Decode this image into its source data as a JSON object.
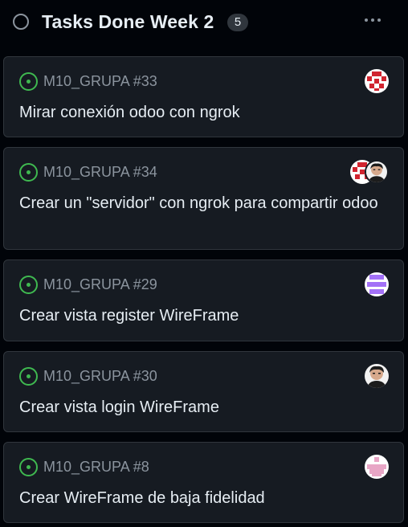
{
  "column": {
    "title": "Tasks Done Week 2",
    "count": "5",
    "menu_icon": "kebab-horizontal-icon"
  },
  "cards": [
    {
      "ref": "M10_GRUPA #33",
      "title": "Mirar conexión odoo con ngrok",
      "status_icon": "issue-opened-icon",
      "assignees": [
        "identicon-red"
      ]
    },
    {
      "ref": "M10_GRUPA #34",
      "title": "Crear un \"servidor\" con ngrok para compartir odoo",
      "status_icon": "issue-opened-icon",
      "assignees": [
        "identicon-red",
        "photo-avatar"
      ]
    },
    {
      "ref": "M10_GRUPA #29",
      "title": "Crear vista register WireFrame",
      "status_icon": "issue-opened-icon",
      "assignees": [
        "identicon-purple"
      ]
    },
    {
      "ref": "M10_GRUPA #30",
      "title": "Crear vista login WireFrame",
      "status_icon": "issue-opened-icon",
      "assignees": [
        "photo-avatar"
      ]
    },
    {
      "ref": "M10_GRUPA #8",
      "title": "Crear WireFrame de baja fidelidad",
      "status_icon": "issue-opened-icon",
      "assignees": [
        "identicon-pink"
      ]
    }
  ],
  "colors": {
    "background": "#010409",
    "card": "#161b22",
    "border": "#30363d",
    "issue_open": "#3fb950",
    "muted_text": "#8b949e",
    "identicon_red": "#d1242f",
    "identicon_purple": "#a371f7",
    "identicon_pink": "#e8a6c6"
  }
}
